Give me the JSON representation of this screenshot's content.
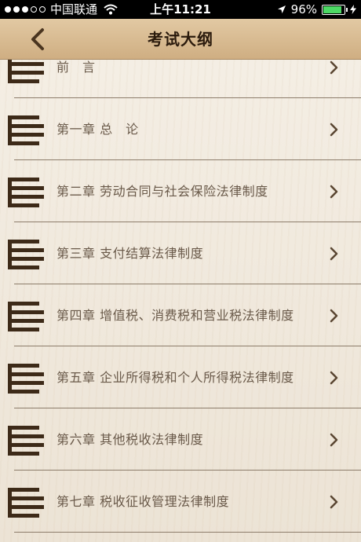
{
  "status_bar": {
    "carrier": "中国联通",
    "time": "上午11:21",
    "battery": "96%",
    "battery_level": 0.96,
    "signal_bars": 3
  },
  "nav": {
    "title": "考试大纲",
    "back_icon": "chevron-left-icon"
  },
  "list": {
    "items": [
      {
        "label": "前　言"
      },
      {
        "label": "第一章  总　论"
      },
      {
        "label": "第二章  劳动合同与社会保险法律制度"
      },
      {
        "label": "第三章  支付结算法律制度"
      },
      {
        "label": "第四章  增值税、消费税和营业税法律制度"
      },
      {
        "label": "第五章  企业所得税和个人所得税法律制度"
      },
      {
        "label": "第六章  其他税收法律制度"
      },
      {
        "label": "第七章  税收征收管理法律制度"
      }
    ],
    "row_icon": "list-icon",
    "chevron_icon": "chevron-right-icon"
  },
  "colors": {
    "nav_bar": "#d7bb92",
    "icon": "#3d2a18",
    "text": "#6a5a4a",
    "divider": "#8c7c6a",
    "battery_fill": "#4cd964"
  }
}
